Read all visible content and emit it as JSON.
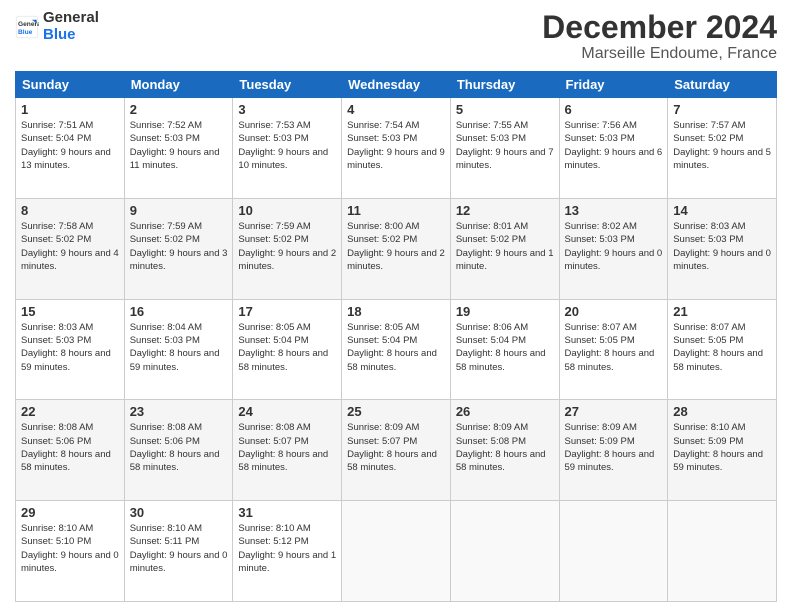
{
  "logo": {
    "line1": "General",
    "line2": "Blue"
  },
  "title": "December 2024",
  "location": "Marseille Endoume, France",
  "days_of_week": [
    "Sunday",
    "Monday",
    "Tuesday",
    "Wednesday",
    "Thursday",
    "Friday",
    "Saturday"
  ],
  "weeks": [
    [
      {
        "day": "1",
        "sunrise": "7:51 AM",
        "sunset": "5:04 PM",
        "daylight": "9 hours and 13 minutes."
      },
      {
        "day": "2",
        "sunrise": "7:52 AM",
        "sunset": "5:03 PM",
        "daylight": "9 hours and 11 minutes."
      },
      {
        "day": "3",
        "sunrise": "7:53 AM",
        "sunset": "5:03 PM",
        "daylight": "9 hours and 10 minutes."
      },
      {
        "day": "4",
        "sunrise": "7:54 AM",
        "sunset": "5:03 PM",
        "daylight": "9 hours and 9 minutes."
      },
      {
        "day": "5",
        "sunrise": "7:55 AM",
        "sunset": "5:03 PM",
        "daylight": "9 hours and 7 minutes."
      },
      {
        "day": "6",
        "sunrise": "7:56 AM",
        "sunset": "5:03 PM",
        "daylight": "9 hours and 6 minutes."
      },
      {
        "day": "7",
        "sunrise": "7:57 AM",
        "sunset": "5:02 PM",
        "daylight": "9 hours and 5 minutes."
      }
    ],
    [
      {
        "day": "8",
        "sunrise": "7:58 AM",
        "sunset": "5:02 PM",
        "daylight": "9 hours and 4 minutes."
      },
      {
        "day": "9",
        "sunrise": "7:59 AM",
        "sunset": "5:02 PM",
        "daylight": "9 hours and 3 minutes."
      },
      {
        "day": "10",
        "sunrise": "7:59 AM",
        "sunset": "5:02 PM",
        "daylight": "9 hours and 2 minutes."
      },
      {
        "day": "11",
        "sunrise": "8:00 AM",
        "sunset": "5:02 PM",
        "daylight": "9 hours and 2 minutes."
      },
      {
        "day": "12",
        "sunrise": "8:01 AM",
        "sunset": "5:02 PM",
        "daylight": "9 hours and 1 minute."
      },
      {
        "day": "13",
        "sunrise": "8:02 AM",
        "sunset": "5:03 PM",
        "daylight": "9 hours and 0 minutes."
      },
      {
        "day": "14",
        "sunrise": "8:03 AM",
        "sunset": "5:03 PM",
        "daylight": "9 hours and 0 minutes."
      }
    ],
    [
      {
        "day": "15",
        "sunrise": "8:03 AM",
        "sunset": "5:03 PM",
        "daylight": "8 hours and 59 minutes."
      },
      {
        "day": "16",
        "sunrise": "8:04 AM",
        "sunset": "5:03 PM",
        "daylight": "8 hours and 59 minutes."
      },
      {
        "day": "17",
        "sunrise": "8:05 AM",
        "sunset": "5:04 PM",
        "daylight": "8 hours and 58 minutes."
      },
      {
        "day": "18",
        "sunrise": "8:05 AM",
        "sunset": "5:04 PM",
        "daylight": "8 hours and 58 minutes."
      },
      {
        "day": "19",
        "sunrise": "8:06 AM",
        "sunset": "5:04 PM",
        "daylight": "8 hours and 58 minutes."
      },
      {
        "day": "20",
        "sunrise": "8:07 AM",
        "sunset": "5:05 PM",
        "daylight": "8 hours and 58 minutes."
      },
      {
        "day": "21",
        "sunrise": "8:07 AM",
        "sunset": "5:05 PM",
        "daylight": "8 hours and 58 minutes."
      }
    ],
    [
      {
        "day": "22",
        "sunrise": "8:08 AM",
        "sunset": "5:06 PM",
        "daylight": "8 hours and 58 minutes."
      },
      {
        "day": "23",
        "sunrise": "8:08 AM",
        "sunset": "5:06 PM",
        "daylight": "8 hours and 58 minutes."
      },
      {
        "day": "24",
        "sunrise": "8:08 AM",
        "sunset": "5:07 PM",
        "daylight": "8 hours and 58 minutes."
      },
      {
        "day": "25",
        "sunrise": "8:09 AM",
        "sunset": "5:07 PM",
        "daylight": "8 hours and 58 minutes."
      },
      {
        "day": "26",
        "sunrise": "8:09 AM",
        "sunset": "5:08 PM",
        "daylight": "8 hours and 58 minutes."
      },
      {
        "day": "27",
        "sunrise": "8:09 AM",
        "sunset": "5:09 PM",
        "daylight": "8 hours and 59 minutes."
      },
      {
        "day": "28",
        "sunrise": "8:10 AM",
        "sunset": "5:09 PM",
        "daylight": "8 hours and 59 minutes."
      }
    ],
    [
      {
        "day": "29",
        "sunrise": "8:10 AM",
        "sunset": "5:10 PM",
        "daylight": "9 hours and 0 minutes."
      },
      {
        "day": "30",
        "sunrise": "8:10 AM",
        "sunset": "5:11 PM",
        "daylight": "9 hours and 0 minutes."
      },
      {
        "day": "31",
        "sunrise": "8:10 AM",
        "sunset": "5:12 PM",
        "daylight": "9 hours and 1 minute."
      },
      null,
      null,
      null,
      null
    ]
  ],
  "labels": {
    "sunrise": "Sunrise:",
    "sunset": "Sunset:",
    "daylight": "Daylight:"
  }
}
